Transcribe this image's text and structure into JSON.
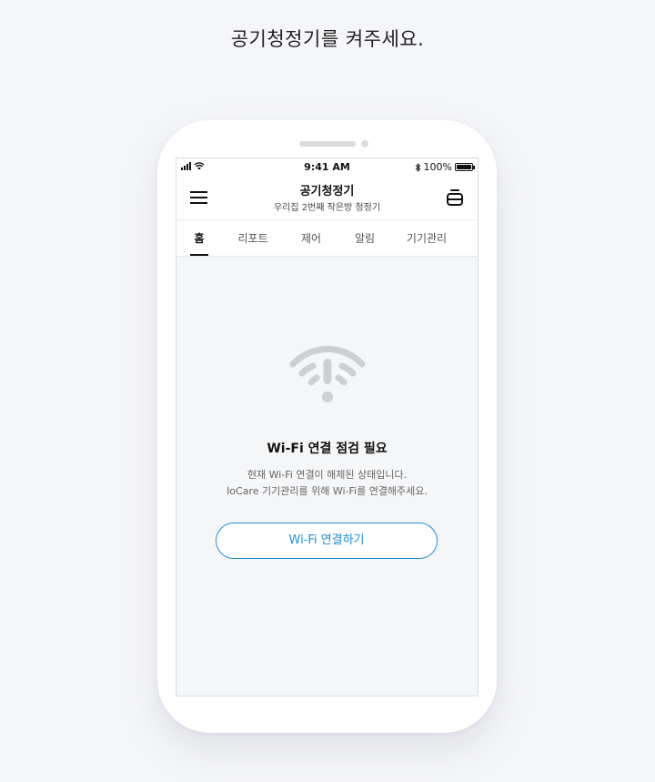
{
  "instruction": "공기청정기를 켜주세요.",
  "status_bar": {
    "time": "9:41 AM",
    "battery_text": "100%",
    "icons": [
      "signal-icon",
      "wifi-status-icon",
      "bluetooth-icon",
      "battery-icon"
    ]
  },
  "header": {
    "title": "공기청정기",
    "subtitle": "우리집 2번째 작은방 청정기",
    "left_icon": "menu-icon",
    "right_icon": "device-list-icon"
  },
  "tabs": [
    {
      "label": "홈",
      "active": true
    },
    {
      "label": "리포트",
      "active": false
    },
    {
      "label": "제어",
      "active": false
    },
    {
      "label": "알림",
      "active": false
    },
    {
      "label": "기기관리",
      "active": false
    }
  ],
  "error": {
    "icon": "wifi-warning-icon",
    "title": "Wi-Fi 연결 점검 필요",
    "description_line1": "현재 Wi-Fi 연결이 해제된 상태입니다.",
    "description_line2": "IoCare 기기관리를 위해 Wi-Fi를 연결해주세요.",
    "button_label": "Wi-Fi 연결하기"
  },
  "colors": {
    "accent": "#1e8fd6",
    "icon_gray": "#cdcfd3",
    "background": "#f5f6f9"
  }
}
